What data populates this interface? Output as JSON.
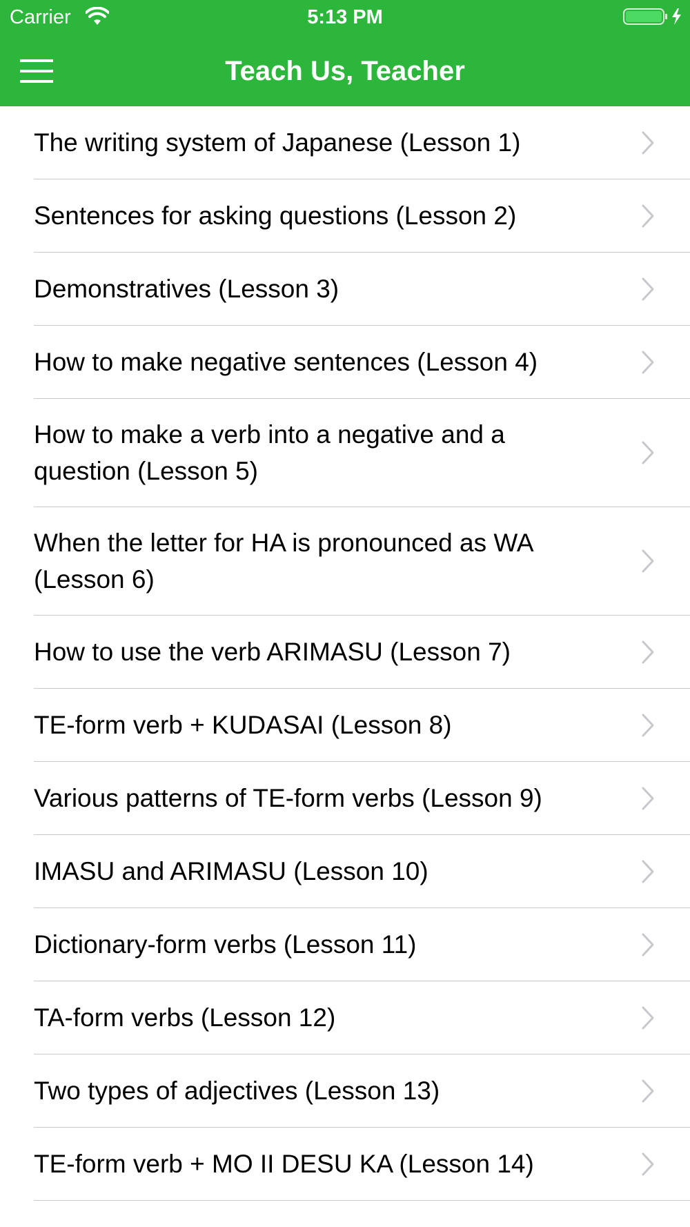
{
  "status_bar": {
    "carrier": "Carrier",
    "time": "5:13 PM",
    "icons": [
      "wifi-icon",
      "battery-icon",
      "charging-bolt-icon"
    ]
  },
  "nav_bar": {
    "title": "Teach Us, Teacher",
    "menu_icon": "hamburger-menu-icon",
    "background_color": "#2cb63c"
  },
  "lessons": [
    {
      "label": "The writing system of Japanese (Lesson 1)"
    },
    {
      "label": "Sentences for asking questions (Lesson 2)"
    },
    {
      "label": "Demonstratives (Lesson 3)"
    },
    {
      "label": "How to make negative sentences (Lesson 4)"
    },
    {
      "label": "How to make a verb into a negative and a question (Lesson 5)"
    },
    {
      "label": "When the letter for HA is pronounced as WA (Lesson 6)"
    },
    {
      "label": "How to use the verb ARIMASU (Lesson 7)"
    },
    {
      "label": "TE-form verb + KUDASAI (Lesson 8)"
    },
    {
      "label": "Various patterns of TE-form verbs (Lesson 9)"
    },
    {
      "label": "IMASU and ARIMASU (Lesson 10)"
    },
    {
      "label": "Dictionary-form verbs (Lesson 11)"
    },
    {
      "label": "TA-form verbs (Lesson 12)"
    },
    {
      "label": "Two types of adjectives (Lesson 13)"
    },
    {
      "label": "TE-form verb + MO II DESU KA (Lesson 14)"
    }
  ],
  "row_icon": "chevron-right-icon"
}
